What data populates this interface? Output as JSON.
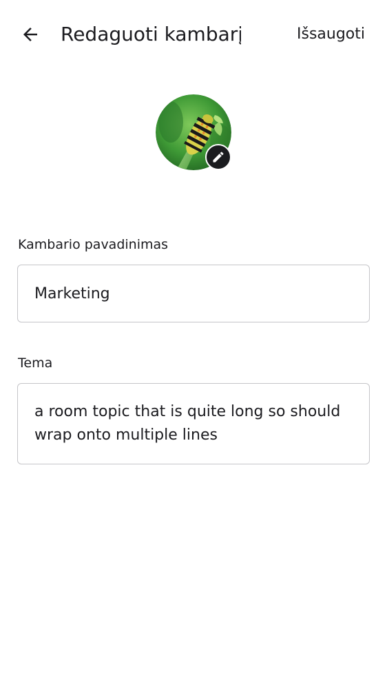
{
  "header": {
    "title": "Redaguoti kambarį",
    "save_label": "Išsaugoti"
  },
  "avatar": {
    "icon": "caterpillar-photo",
    "edit_icon": "pencil-icon"
  },
  "form": {
    "name_label": "Kambario pavadinimas",
    "name_value": "Marketing",
    "topic_label": "Tema",
    "topic_value": "a room topic that is quite long so should wrap onto multiple lines"
  },
  "colors": {
    "text": "#1b1b1f",
    "border": "#c4c4c8",
    "badge": "#1b1c1f"
  }
}
